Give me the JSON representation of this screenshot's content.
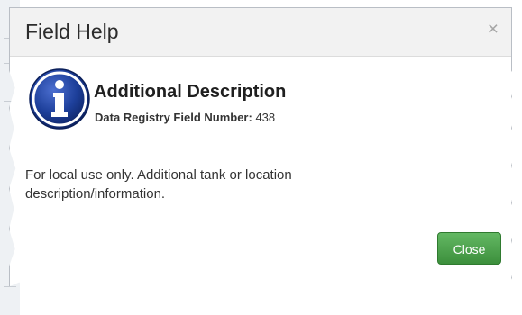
{
  "dialog": {
    "title": "Field Help",
    "close_glyph": "×",
    "icon": "info-icon",
    "field_name": "Additional Description",
    "registry_label": "Data Registry Field Number:",
    "registry_value": "438",
    "description": "For local use only. Additional tank or location description/information.",
    "close_button_label": "Close",
    "colors": {
      "close_button": "#4aa34a",
      "info_icon": "#1d3f9a",
      "header_bg": "#f2f2f2"
    }
  }
}
